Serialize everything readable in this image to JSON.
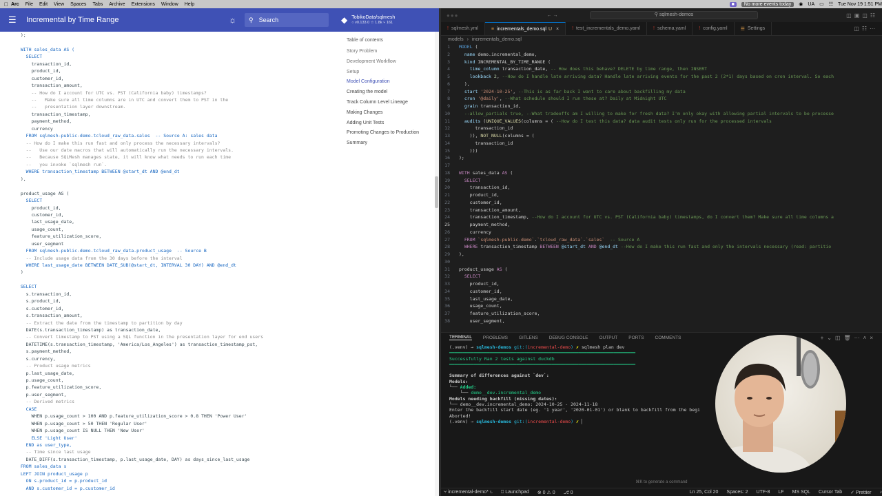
{
  "menubar": {
    "app": "Arc",
    "items": [
      "File",
      "Edit",
      "View",
      "Spaces",
      "Tabs",
      "Archive",
      "Extensions",
      "Window",
      "Help"
    ],
    "events": "No more events today",
    "lang": "UA",
    "clock": "Tue Nov 19  1:51 PM"
  },
  "doc": {
    "title": "Incremental by Time Range",
    "search_placeholder": "Search",
    "repo_name": "TobikoData/sqlmesh",
    "repo_stats": "○ v0.133.0  ☆ 1.8k  ⑂ 161",
    "code_lines": [
      "  );",
      "",
      "  WITH sales_data AS (",
      "    SELECT",
      "      transaction_id,",
      "      product_id,",
      "      customer_id,",
      "      transaction_amount,",
      "      -- How do I account for UTC vs. PST (California baby) timestamps?",
      "      --   Make sure all time columns are in UTC and convert them to PST in the",
      "      --   presentation layer downstream.",
      "      transaction_timestamp,",
      "      payment_method,",
      "      currency",
      "    FROM sqlmesh-public-demo.tcloud_raw_data.sales  -- Source A: sales data",
      "    -- How do I make this run fast and only process the necessary intervals?",
      "    --   Use our date macros that will automatically run the necessary intervals.",
      "    --   Because SQLMesh manages state, it will know what needs to run each time",
      "    --   you invoke `sqlmesh run`.",
      "    WHERE transaction_timestamp BETWEEN @start_dt AND @end_dt",
      "  ),",
      "",
      "  product_usage AS (",
      "    SELECT",
      "      product_id,",
      "      customer_id,",
      "      last_usage_date,",
      "      usage_count,",
      "      feature_utilization_score,",
      "      user_segment",
      "    FROM sqlmesh-public-demo.tcloud_raw_data.product_usage  -- Source B",
      "    -- Include usage data from the 30 days before the interval",
      "    WHERE last_usage_date BETWEEN DATE_SUB(@start_dt, INTERVAL 30 DAY) AND @end_dt",
      "  )",
      "",
      "  SELECT",
      "    s.transaction_id,",
      "    s.product_id,",
      "    s.customer_id,",
      "    s.transaction_amount,",
      "    -- Extract the date from the timestamp to partition by day",
      "    DATE(s.transaction_timestamp) as transaction_date,",
      "    -- Convert timestamp to PST using a SQL function in the presentation layer for end users",
      "    DATETIME(s.transaction_timestamp, 'America/Los_Angeles') as transaction_timestamp_pst,",
      "    s.payment_method,",
      "    s.currency,",
      "    -- Product usage metrics",
      "    p.last_usage_date,",
      "    p.usage_count,",
      "    p.feature_utilization_score,",
      "    p.user_segment,",
      "    -- Derived metrics",
      "    CASE",
      "      WHEN p.usage_count > 100 AND p.feature_utilization_score > 0.8 THEN 'Power User'",
      "      WHEN p.usage_count > 50 THEN 'Regular User'",
      "      WHEN p.usage_count IS NULL THEN 'New User'",
      "      ELSE 'Light User'",
      "    END as user_type,",
      "    -- Time since last usage",
      "    DATE_DIFF(s.transaction_timestamp, p.last_usage_date, DAY) as days_since_last_usage",
      "  FROM sales_data s",
      "  LEFT JOIN product_usage p",
      "    ON s.product_id = p.product_id",
      "    AND s.customer_id = p.customer_id"
    ],
    "toc_title": "Table of contents",
    "toc": [
      {
        "label": "Story Problem",
        "state": "muted"
      },
      {
        "label": "Development Workflow",
        "state": "muted"
      },
      {
        "label": "Setup",
        "state": "muted"
      },
      {
        "label": "Model Configuration",
        "state": "active"
      },
      {
        "label": "Creating the model",
        "state": "dark"
      },
      {
        "label": "Track Column Level Lineage",
        "state": "dark"
      },
      {
        "label": "Making Changes",
        "state": "dark"
      },
      {
        "label": "Adding Unit Tests",
        "state": "dark"
      },
      {
        "label": "Promoting Changes to Production",
        "state": "dark"
      },
      {
        "label": "Summary",
        "state": "dark"
      }
    ]
  },
  "vscode": {
    "command_center": "sqlmesh-demos",
    "tabs": [
      {
        "label": "sqlmesh.yml",
        "icon": "!",
        "modified": "",
        "active": false
      },
      {
        "label": "incrementals_demo.sql",
        "icon": "≡",
        "modified": "U",
        "active": true
      },
      {
        "label": "test_incrementals_demo.yaml",
        "icon": "!",
        "modified": "",
        "active": false
      },
      {
        "label": "schema.yaml",
        "icon": "!",
        "modified": "",
        "active": false
      },
      {
        "label": "config.yaml",
        "icon": "!",
        "modified": "",
        "active": false
      },
      {
        "label": "Settings",
        "icon": "☰",
        "modified": "",
        "active": false
      }
    ],
    "breadcrumbs": [
      "models",
      "incrementals_demo.sql"
    ],
    "editor_lines": [
      {
        "n": "1",
        "html": "<span class='k2'>MODEL</span> ("
      },
      {
        "n": "2",
        "html": "  <span class='v'>name</span> demo.incremental_demo,"
      },
      {
        "n": "3",
        "html": "  <span class='v'>kind</span> INCREMENTAL_BY_TIME_RANGE ("
      },
      {
        "n": "4",
        "html": "    <span class='v'>time_column</span> transaction_date, <span class='c'>-- How does this behave? DELETE by time range, then INSERT</span>"
      },
      {
        "n": "5",
        "html": "    <span class='v'>lookback</span> <span class='n'>2</span>, <span class='c'>--How do I handle late arriving data? Handle late arriving events for the past 2 (2*1) days based on cron interval. So each</span>"
      },
      {
        "n": "6",
        "html": "  ),"
      },
      {
        "n": "7",
        "html": "  <span class='v'>start</span> <span class='s'>'2024-10-25'</span>, <span class='c'>--This is as far back I want to care about backfilling my data</span>"
      },
      {
        "n": "8",
        "html": "  <span class='v'>cron</span> <span class='s'>'@daily'</span>, <span class='c'>--What schedule should I run these at? Daily at Midnight UTC</span>"
      },
      {
        "n": "9",
        "html": "  <span class='v'>grain</span> transaction_id,"
      },
      {
        "n": "10",
        "html": "  <span class='c'>--allow_partials true, --What tradeoffs am I willing to make for fresh data? I'm only okay with allowing partial intervals to be processe</span>"
      },
      {
        "n": "11",
        "html": "  <span class='v'>audits</span> (<span class='f'>UNIQUE_VALUES</span>(columns = ( <span class='c'>--How do I test this data? data audit tests only run for the processed intervals</span>"
      },
      {
        "n": "12",
        "html": "      transaction_id"
      },
      {
        "n": "13",
        "html": "    )), <span class='f'>NOT_NULL</span>(columns = ("
      },
      {
        "n": "14",
        "html": "      transaction_id"
      },
      {
        "n": "15",
        "html": "    )))"
      },
      {
        "n": "16",
        "html": ");"
      },
      {
        "n": "17",
        "html": ""
      },
      {
        "n": "18",
        "html": "<span class='k'>WITH</span> sales_data <span class='k'>AS</span> ("
      },
      {
        "n": "19",
        "html": "  <span class='k'>SELECT</span>"
      },
      {
        "n": "20",
        "html": "    transaction_id,"
      },
      {
        "n": "21",
        "html": "    product_id,"
      },
      {
        "n": "22",
        "html": "    customer_id,"
      },
      {
        "n": "23",
        "html": "    transaction_amount,"
      },
      {
        "n": "24",
        "html": "    transaction_timestamp, <span class='c'>--How do I account for UTC vs. PST (California baby) timestamps, do I convert them? Make sure all time columns a</span>"
      },
      {
        "n": "25",
        "html": "    payment_method,"
      },
      {
        "n": "26",
        "html": "    currency"
      },
      {
        "n": "27",
        "html": "  <span class='k'>FROM</span> <span class='s'>`sqlmesh-public-demo`</span>.<span class='s'>`tcloud_raw_data`</span>.<span class='s'>`sales`</span>  <span class='c'>-- Source A</span>"
      },
      {
        "n": "28",
        "html": "  <span class='k'>WHERE</span> transaction_timestamp <span class='k'>BETWEEN</span> <span class='v'>@start_dt</span> <span class='k'>AND</span> <span class='v'>@end_dt</span> <span class='c'>--How do I make this run fast and only the intervals necessary (read: partitio</span>"
      },
      {
        "n": "29",
        "html": "),"
      },
      {
        "n": "30",
        "html": ""
      },
      {
        "n": "31",
        "html": "product_usage <span class='k'>AS</span> ("
      },
      {
        "n": "32",
        "html": "  <span class='k'>SELECT</span>"
      },
      {
        "n": "33",
        "html": "    product_id,"
      },
      {
        "n": "34",
        "html": "    customer_id,"
      },
      {
        "n": "35",
        "html": "    last_usage_date,"
      },
      {
        "n": "36",
        "html": "    usage_count,"
      },
      {
        "n": "37",
        "html": "    feature_utilization_score,"
      },
      {
        "n": "38",
        "html": "    user_segment,"
      }
    ],
    "current_line": "25",
    "panel_tabs": [
      "TERMINAL",
      "PROBLEMS",
      "GITLENS",
      "DEBUG CONSOLE",
      "OUTPUT",
      "PORTS",
      "COMMENTS"
    ],
    "terminal_lines": [
      {
        "cls": "",
        "html": "(.venv) → <span class='tc tbld'>sqlmesh-demos</span> <span class='tc'>git:(</span><span style='color:#f14c4c'>incremental-demo</span><span class='tc'>)</span> <span style='color:#e5e510'>✗</span> sqlmesh plan dev"
      },
      {
        "cls": "",
        "html": "<span class='tg'>━━━━━━━━━━━━━━━━━━━━━━━━━━━━━━━━━━━━━━━━━━━━━━━━━━━━━━━━━━━━━━━━━━━━━</span>"
      },
      {
        "cls": "tg",
        "html": "Successfully Ran 2 tests against duckdb"
      },
      {
        "cls": "",
        "html": "<span class='tg'>━━━━━━━━━━━━━━━━━━━━━━━━━━━━━━━━━━━━━━━━━━━━━━━━━━━━━━━━━━━━━━━━━━━━━</span>"
      },
      {
        "cls": "",
        "html": ""
      },
      {
        "cls": "tbld",
        "html": "Summary of differences against `dev`:"
      },
      {
        "cls": "tbld",
        "html": "Models:"
      },
      {
        "cls": "",
        "html": "└── <span class='tg tbld'>Added:</span>"
      },
      {
        "cls": "",
        "html": "    └── <span class='tg'>demo__dev.incremental_demo</span>"
      },
      {
        "cls": "tbld",
        "html": "Models needing backfill (missing dates):"
      },
      {
        "cls": "",
        "html": "└── demo__dev.incremental_demo: 2024-10-25 - 2024-11-18"
      },
      {
        "cls": "",
        "html": "Enter the backfill start date (eg. '1 year', '2020-01-01') or blank to backfill from the begi"
      },
      {
        "cls": "",
        "html": "Aborted!"
      },
      {
        "cls": "",
        "html": "(.venv) → <span class='tc tbld'>sqlmesh-demos</span> <span class='tc'>git:(</span><span style='color:#f14c4c'>incremental-demo</span><span class='tc'>)</span> <span style='color:#e5e510'>✗</span> ▏"
      }
    ],
    "hint": "⌘K to generate a command",
    "status_left": [
      "⑂ incremental-demo* ↻",
      "⎕ Launchpad",
      "⊗ 0 ⚠ 0",
      "⎇ 0"
    ],
    "status_right": [
      "Ln 25, Col 20",
      "Spaces: 2",
      "UTF-8",
      "LF",
      "MS SQL",
      "Cursor Tab",
      "✓ Prettier",
      "♪"
    ]
  }
}
